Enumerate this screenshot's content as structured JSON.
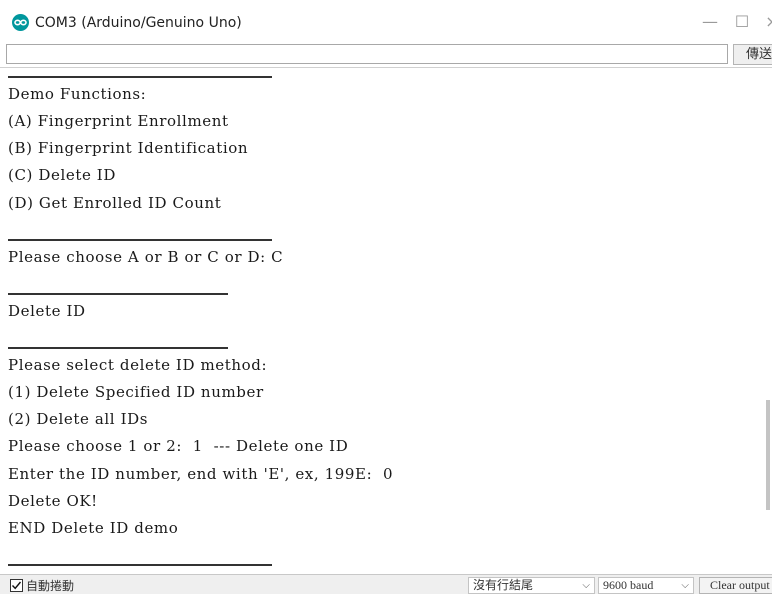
{
  "window": {
    "title": "COM3 (Arduino/Genuino Uno)",
    "minimize_glyph": "—",
    "maximize_glyph": "☐",
    "close_glyph": "×",
    "app_icon": "arduino-infinity-icon"
  },
  "send": {
    "input_value": "",
    "button_label": "傳送"
  },
  "output": {
    "separator_glyph": "=",
    "lines": [
      {
        "kind": "sep",
        "text": ""
      },
      {
        "kind": "text",
        "text": "Demo Functions:"
      },
      {
        "kind": "text",
        "text": "(A) Fingerprint Enrollment"
      },
      {
        "kind": "text",
        "text": "(B) Fingerprint Identification"
      },
      {
        "kind": "text",
        "text": "(C) Delete ID"
      },
      {
        "kind": "text",
        "text": "(D) Get Enrolled ID Count"
      },
      {
        "kind": "sep",
        "text": ""
      },
      {
        "kind": "text",
        "text": "Please choose A or B or C or D: C"
      },
      {
        "kind": "sep",
        "text": ""
      },
      {
        "kind": "text",
        "text": "Delete ID"
      },
      {
        "kind": "sep",
        "text": ""
      },
      {
        "kind": "text",
        "text": "Please select delete ID method:"
      },
      {
        "kind": "text",
        "text": "(1) Delete Specified ID number"
      },
      {
        "kind": "text",
        "text": "(2) Delete all IDs"
      },
      {
        "kind": "text",
        "text": "Please choose 1 or 2:  1  --- Delete one ID"
      },
      {
        "kind": "text",
        "text": "Enter the ID number, end with 'E', ex, 199E:  0"
      },
      {
        "kind": "text",
        "text": "Delete OK!"
      },
      {
        "kind": "text",
        "text": "END Delete ID demo"
      },
      {
        "kind": "sep",
        "text": ""
      }
    ]
  },
  "statusbar": {
    "autoscroll_checked": true,
    "autoscroll_label": "自動捲動",
    "line_ending": "沒有行結尾",
    "baud": "9600 baud",
    "clear_label": "Clear output"
  },
  "colors": {
    "arduino_teal": "#00979d",
    "background": "#ffffff",
    "statusbar_bg": "#efefef"
  }
}
